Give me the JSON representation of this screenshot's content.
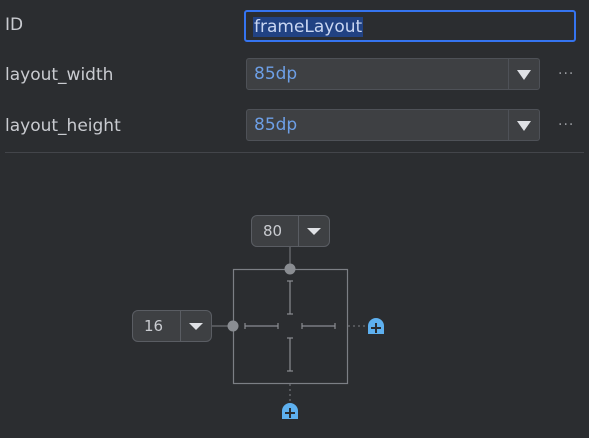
{
  "attributes": {
    "id": {
      "label": "ID",
      "value": "frameLayout"
    },
    "layout_width": {
      "label": "layout_width",
      "value": "85dp",
      "more": "···"
    },
    "layout_height": {
      "label": "layout_height",
      "value": "85dp",
      "more": "···"
    }
  },
  "constraint_widget": {
    "top_margin": "80",
    "start_margin": "16"
  },
  "colors": {
    "background": "#2b2d30",
    "accent": "#3574f0",
    "value_text": "#6d9fe6",
    "add_constraint_icon": "#5eb0ef"
  },
  "icons": [
    "dropdown-arrow-icon",
    "more-options-icon",
    "add-constraint-icon"
  ]
}
